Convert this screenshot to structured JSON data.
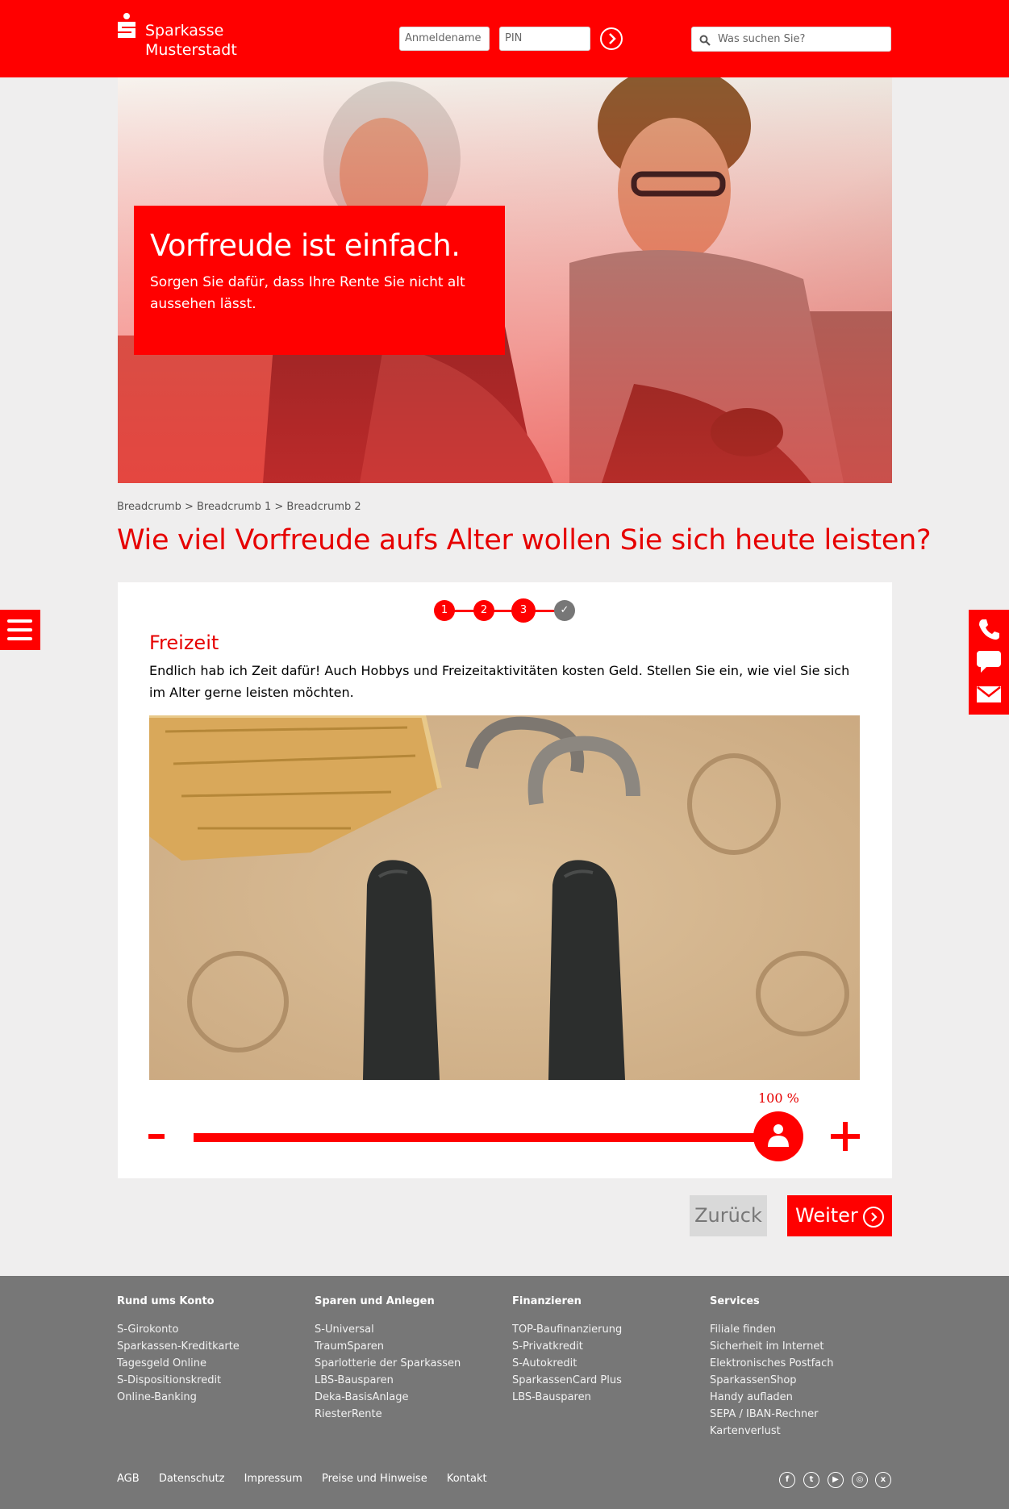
{
  "header": {
    "brand_line1": "Sparkasse",
    "brand_line2": "Musterstadt",
    "login_placeholder": "Anmeldename",
    "pin_placeholder": "PIN",
    "search_placeholder": "Was suchen Sie?",
    "accent": "#ff0000"
  },
  "hero": {
    "title": "Vorfreude ist einfach.",
    "subtitle": "Sorgen Sie dafür, dass Ihre Rente Sie nicht alt aussehen lässt."
  },
  "breadcrumb": "Breadcrumb > Breadcrumb 1 > Breadcrumb 2",
  "page_title": "Wie viel Vorfreude aufs Alter wollen Sie sich heute leisten?",
  "wizard": {
    "steps": [
      "1",
      "2",
      "3",
      "✓"
    ],
    "current_step": 3,
    "section_title": "Freizeit",
    "section_desc": "Endlich hab ich Zeit dafür! Auch Hobbys und Freizeitaktivitäten kosten Geld. Stellen Sie ein, wie viel Sie sich im Alter gerne leisten möchten.",
    "slider_value_label": "100 %",
    "slider_value": 1.0,
    "minus_label": "-",
    "plus_label": "+"
  },
  "buttons": {
    "back": "Zurück",
    "next": "Weiter"
  },
  "side": {
    "menu_icon": "hamburger-icon",
    "contact_icons": [
      "phone-icon",
      "chat-icon",
      "mail-icon"
    ]
  },
  "footer": {
    "columns": [
      {
        "title": "Rund ums Konto",
        "items": [
          "S-Girokonto",
          "Sparkassen-Kreditkarte",
          "Tagesgeld Online",
          "S-Dispositionskredit",
          "Online-Banking"
        ]
      },
      {
        "title": "Sparen und Anlegen",
        "items": [
          "S-Universal",
          "TraumSparen",
          "Sparlotterie der Sparkassen",
          "LBS-Bausparen",
          "Deka-BasisAnlage",
          "RiesterRente"
        ]
      },
      {
        "title": "Finanzieren",
        "items": [
          "TOP-Baufinanzierung",
          "S-Privatkredit",
          "S-Autokredit",
          "SparkassenCard Plus",
          "LBS-Bausparen"
        ]
      },
      {
        "title": "Services",
        "items": [
          "Filiale finden",
          "Sicherheit im Internet",
          "Elektronisches Postfach",
          "SparkassenShop",
          "Handy aufladen",
          "SEPA / IBAN-Rechner",
          "Kartenverlust"
        ]
      }
    ],
    "links": [
      "AGB",
      "Datenschutz",
      "Impressum",
      "Preise und Hinweise",
      "Kontakt"
    ],
    "social_icons": [
      "facebook-icon",
      "twitter-icon",
      "youtube-icon",
      "instagram-icon",
      "xing-icon"
    ]
  }
}
